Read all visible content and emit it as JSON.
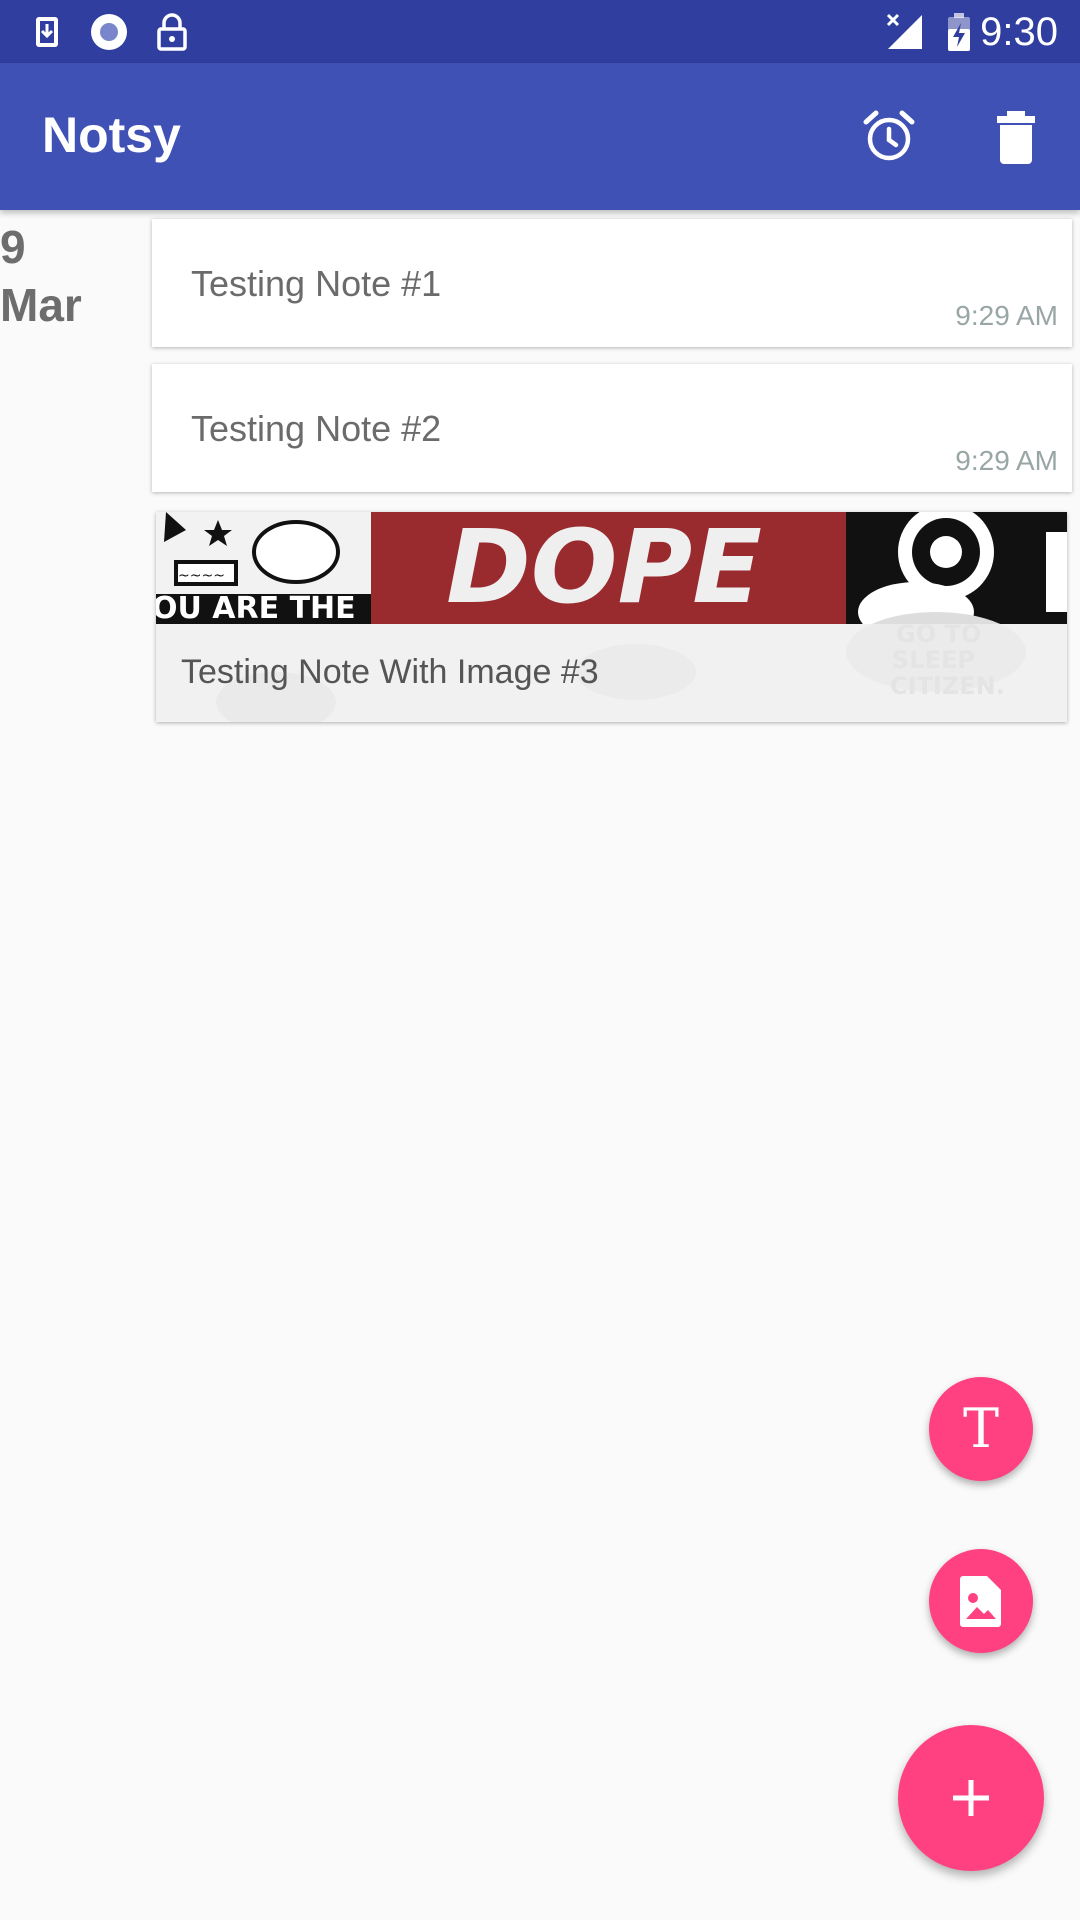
{
  "status_bar": {
    "time": "9:30",
    "icons": [
      "download-icon",
      "record-icon",
      "lock-icon",
      "signal-icon",
      "battery-charging-icon"
    ]
  },
  "app_bar": {
    "title": "Notsy",
    "actions": [
      "alarm-icon",
      "delete-icon"
    ],
    "color": "#3f51b5",
    "status_color": "#303f9f"
  },
  "date_group": {
    "day": "9",
    "month": "Mar"
  },
  "notes": [
    {
      "title": "Testing Note #1",
      "time": "9:29 AM"
    },
    {
      "title": "Testing Note #2",
      "time": "9:29 AM"
    },
    {
      "title": "Testing Note With Image #3",
      "image_text": "DOPE",
      "has_image": true
    }
  ],
  "fabs": {
    "text_note_icon": "T",
    "image_note_icon": "image-note-icon",
    "add_icon": "plus-icon",
    "accent": "#ff4081"
  }
}
